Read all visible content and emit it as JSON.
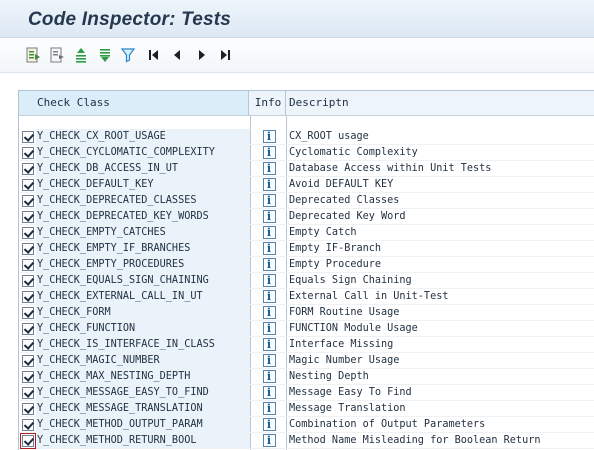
{
  "window": {
    "title": "Code Inspector: Tests"
  },
  "toolbar": {
    "buttons": [
      {
        "name": "details-icon",
        "color": "#3e8c3b"
      },
      {
        "name": "select-layout-icon",
        "color": "#5f6b78"
      },
      {
        "name": "sort-ascending-icon",
        "color": "#2f9b47"
      },
      {
        "name": "sort-descending-icon",
        "color": "#2f9b47"
      },
      {
        "name": "filter-icon",
        "color": "#2a86c8"
      },
      {
        "name": "first-page-icon",
        "color": "#1f1f1f"
      },
      {
        "name": "previous-page-icon",
        "color": "#1f1f1f"
      },
      {
        "name": "next-page-icon",
        "color": "#1f1f1f"
      },
      {
        "name": "last-page-icon",
        "color": "#1f1f1f"
      }
    ]
  },
  "table": {
    "headers": {
      "check_class": "Check Class",
      "info": "Info",
      "description": "Descriptn"
    },
    "rows": [
      {
        "checked": true,
        "check_class": "Y_CHECK_CX_ROOT_USAGE",
        "description": "CX_ROOT usage"
      },
      {
        "checked": true,
        "check_class": "Y_CHECK_CYCLOMATIC_COMPLEXITY",
        "description": "Cyclomatic Complexity"
      },
      {
        "checked": true,
        "check_class": "Y_CHECK_DB_ACCESS_IN_UT",
        "description": "Database Access within Unit Tests"
      },
      {
        "checked": true,
        "check_class": "Y_CHECK_DEFAULT_KEY",
        "description": "Avoid DEFAULT KEY"
      },
      {
        "checked": true,
        "check_class": "Y_CHECK_DEPRECATED_CLASSES",
        "description": "Deprecated Classes"
      },
      {
        "checked": true,
        "check_class": "Y_CHECK_DEPRECATED_KEY_WORDS",
        "description": "Deprecated Key Word"
      },
      {
        "checked": true,
        "check_class": "Y_CHECK_EMPTY_CATCHES",
        "description": "Empty Catch"
      },
      {
        "checked": true,
        "check_class": "Y_CHECK_EMPTY_IF_BRANCHES",
        "description": "Empty IF-Branch"
      },
      {
        "checked": true,
        "check_class": "Y_CHECK_EMPTY_PROCEDURES",
        "description": "Empty Procedure"
      },
      {
        "checked": true,
        "check_class": "Y_CHECK_EQUALS_SIGN_CHAINING",
        "description": "Equals Sign Chaining"
      },
      {
        "checked": true,
        "check_class": "Y_CHECK_EXTERNAL_CALL_IN_UT",
        "description": "External Call in Unit-Test"
      },
      {
        "checked": true,
        "check_class": "Y_CHECK_FORM",
        "description": "FORM Routine Usage"
      },
      {
        "checked": true,
        "check_class": "Y_CHECK_FUNCTION",
        "description": "FUNCTION Module Usage"
      },
      {
        "checked": true,
        "check_class": "Y_CHECK_IS_INTERFACE_IN_CLASS",
        "description": "Interface Missing"
      },
      {
        "checked": true,
        "check_class": "Y_CHECK_MAGIC_NUMBER",
        "description": "Magic Number Usage"
      },
      {
        "checked": true,
        "check_class": "Y_CHECK_MAX_NESTING_DEPTH",
        "description": "Nesting Depth"
      },
      {
        "checked": true,
        "check_class": "Y_CHECK_MESSAGE_EASY_TO_FIND",
        "description": "Message Easy To Find"
      },
      {
        "checked": true,
        "check_class": "Y_CHECK_MESSAGE_TRANSLATION",
        "description": "Message Translation"
      },
      {
        "checked": true,
        "check_class": "Y_CHECK_METHOD_OUTPUT_PARAM",
        "description": "Combination of Output Parameters"
      },
      {
        "checked": true,
        "check_class": "Y_CHECK_METHOD_RETURN_BOOL",
        "description": "Method Name Misleading for Boolean Return"
      }
    ],
    "info_icon_glyph": "i",
    "colors": {
      "header_highlight": "#d9eef9",
      "check_class_cell": "#eaf2fa",
      "focus_outline": "#b21d1d"
    }
  }
}
